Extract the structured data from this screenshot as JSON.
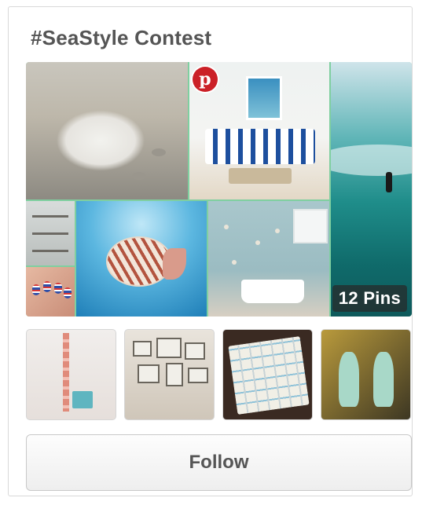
{
  "board": {
    "title": "#SeaStyle Contest",
    "pin_count_label": "12 Pins",
    "follow_label": "Follow"
  },
  "icons": {
    "pinterest_logo": "pinterest-icon",
    "pinterest_glyph": "p"
  },
  "colors": {
    "pinterest_red": "#cb2027",
    "mosaic_border": "#7fcfa0",
    "title_text": "#555555"
  }
}
